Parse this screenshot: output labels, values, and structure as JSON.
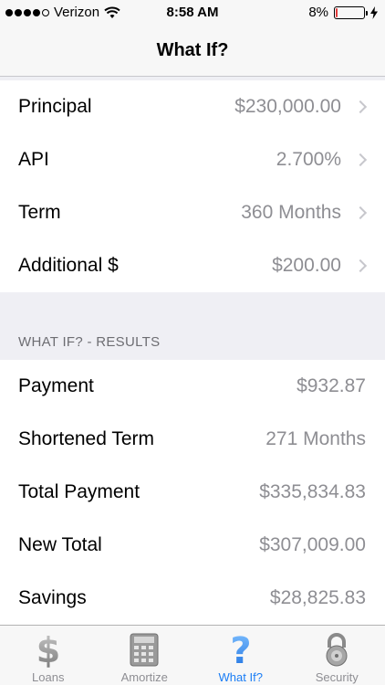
{
  "status_bar": {
    "carrier": "Verizon",
    "signal_bars": 4,
    "time": "8:58 AM",
    "battery_percent": "8%",
    "battery_level": 0.08,
    "battery_color": "#e23c3c"
  },
  "nav": {
    "title": "What If?"
  },
  "inputs": [
    {
      "label": "Principal",
      "value": "$230,000.00"
    },
    {
      "label": "API",
      "value": "2.700%"
    },
    {
      "label": "Term",
      "value": "360 Months"
    },
    {
      "label": "Additional $",
      "value": "$200.00"
    }
  ],
  "results_header": "WHAT IF? - RESULTS",
  "results": [
    {
      "label": "Payment",
      "value": "$932.87"
    },
    {
      "label": "Shortened Term",
      "value": "271 Months"
    },
    {
      "label": "Total Payment",
      "value": "$335,834.83"
    },
    {
      "label": "New Total",
      "value": "$307,009.00"
    },
    {
      "label": "Savings",
      "value": "$28,825.83"
    }
  ],
  "tabs": [
    {
      "label": "Loans",
      "icon": "dollar-icon",
      "active": false
    },
    {
      "label": "Amortize",
      "icon": "calculator-icon",
      "active": false
    },
    {
      "label": "What If?",
      "icon": "question-icon",
      "active": true
    },
    {
      "label": "Security",
      "icon": "lock-icon",
      "active": false
    }
  ],
  "colors": {
    "accent": "#1a7df5",
    "secondary_text": "#8e8e93",
    "background": "#efeff4"
  }
}
